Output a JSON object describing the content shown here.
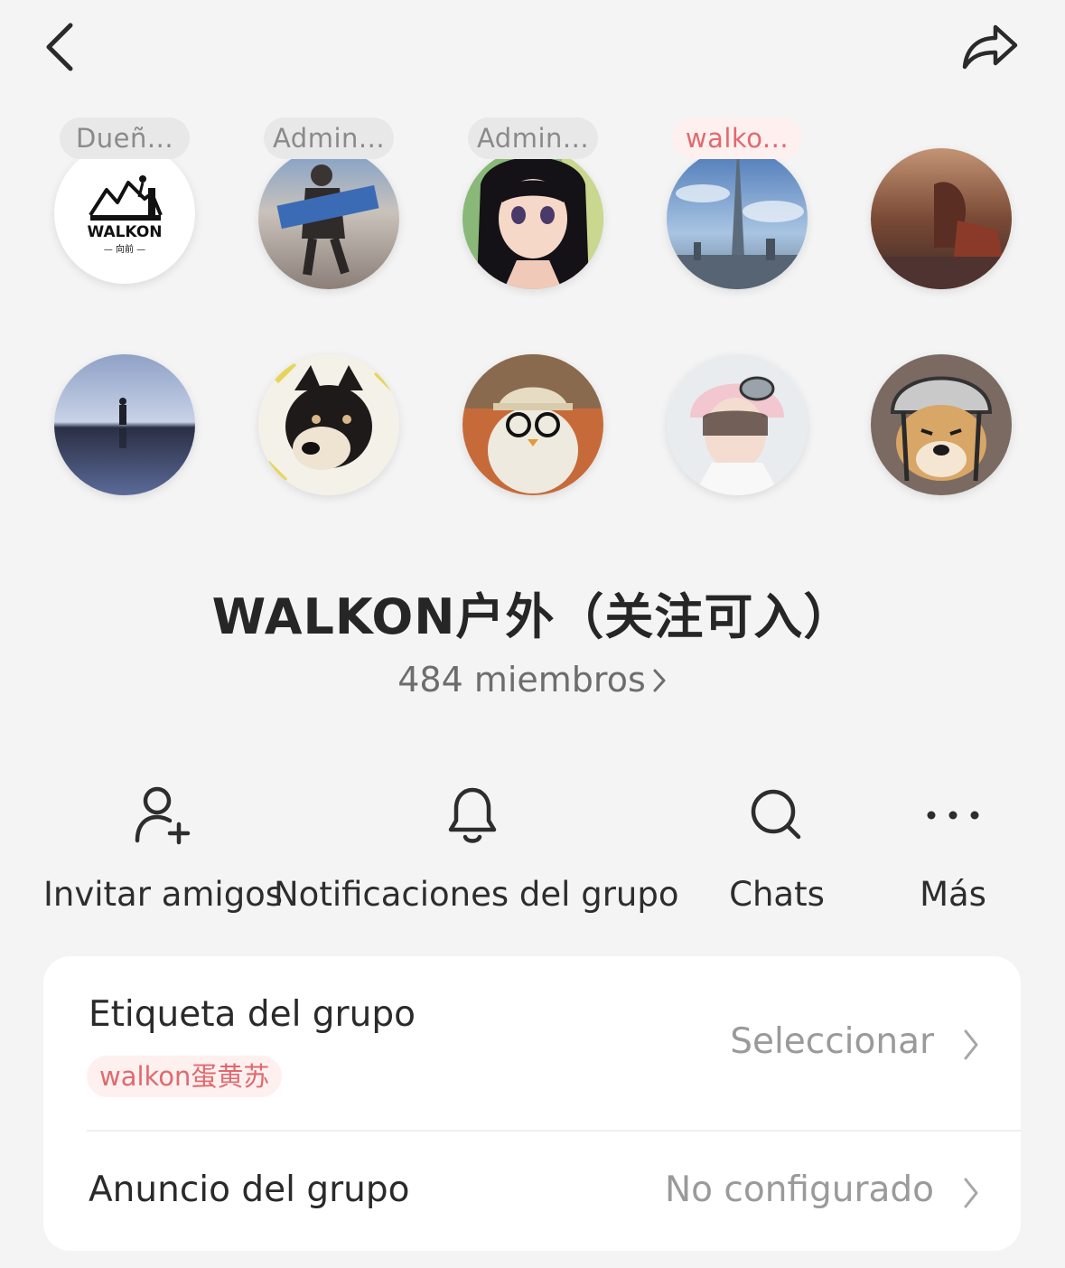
{
  "header": {
    "back_icon": "chevron-left-icon",
    "share_icon": "share-forward-icon"
  },
  "members": {
    "row1": [
      {
        "role": "Dueñ...",
        "avatar": "walkon-logo-avatar",
        "logo_text": "WALKON",
        "logo_sub": "— 向前 —"
      },
      {
        "role": "Admin...",
        "avatar": "person-holding-banner-avatar"
      },
      {
        "role": "Admin...",
        "avatar": "anime-girl-avatar"
      },
      {
        "role": "walko...",
        "avatar": "skyscraper-avatar"
      },
      {
        "role": "",
        "avatar": "woman-in-field-avatar"
      }
    ],
    "row2": [
      {
        "avatar": "lake-reflection-avatar"
      },
      {
        "avatar": "shiba-puppy-avatar"
      },
      {
        "avatar": "plush-toy-glasses-avatar"
      },
      {
        "avatar": "girl-helmet-avatar"
      },
      {
        "avatar": "dog-helmet-avatar"
      }
    ]
  },
  "group": {
    "name": "WALKON户外（关注可入）",
    "members_count": "484 miembros"
  },
  "actions": [
    {
      "label": "Invitar amigos",
      "icon": "add-user-icon"
    },
    {
      "label": "Notificaciones del grupo",
      "icon": "bell-icon"
    },
    {
      "label": "Chats",
      "icon": "search-icon"
    },
    {
      "label": "Más",
      "icon": "more-dots-icon"
    }
  ],
  "settings": {
    "tag_row": {
      "title": "Etiqueta del grupo",
      "value": "Seleccionar",
      "chip": "walkon蛋黄苏"
    },
    "announcement_row": {
      "title": "Anuncio del grupo",
      "value": "No configurado"
    }
  },
  "colors": {
    "background": "#f4f4f4",
    "accent_pink": "#e06a6e",
    "pill_gray": "#e8e8e8"
  }
}
